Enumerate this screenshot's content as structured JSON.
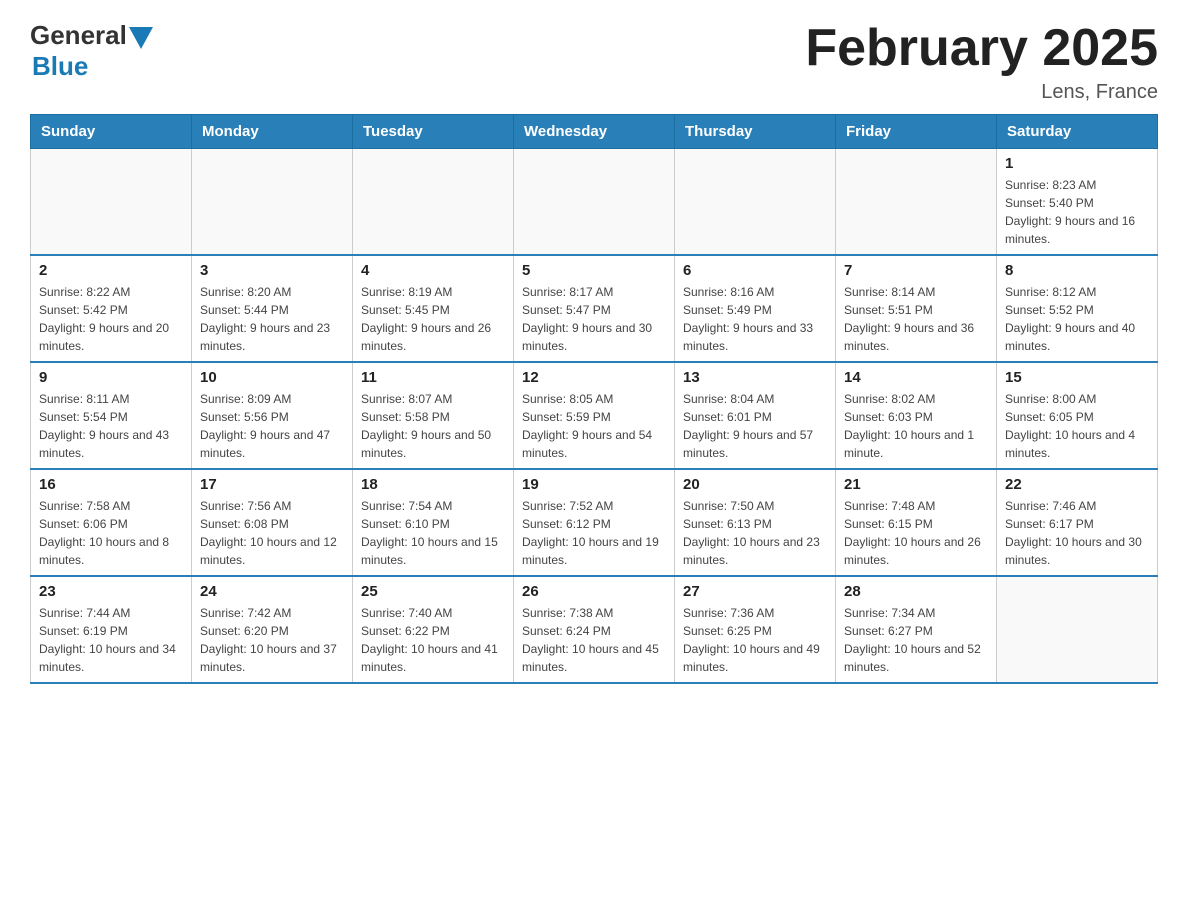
{
  "header": {
    "logo_general": "General",
    "logo_blue": "Blue",
    "month_title": "February 2025",
    "location": "Lens, France"
  },
  "days_of_week": [
    "Sunday",
    "Monday",
    "Tuesday",
    "Wednesday",
    "Thursday",
    "Friday",
    "Saturday"
  ],
  "weeks": [
    [
      {
        "date": "",
        "sunrise": "",
        "sunset": "",
        "daylight": "",
        "empty": true
      },
      {
        "date": "",
        "sunrise": "",
        "sunset": "",
        "daylight": "",
        "empty": true
      },
      {
        "date": "",
        "sunrise": "",
        "sunset": "",
        "daylight": "",
        "empty": true
      },
      {
        "date": "",
        "sunrise": "",
        "sunset": "",
        "daylight": "",
        "empty": true
      },
      {
        "date": "",
        "sunrise": "",
        "sunset": "",
        "daylight": "",
        "empty": true
      },
      {
        "date": "",
        "sunrise": "",
        "sunset": "",
        "daylight": "",
        "empty": true
      },
      {
        "date": "1",
        "sunrise": "Sunrise: 8:23 AM",
        "sunset": "Sunset: 5:40 PM",
        "daylight": "Daylight: 9 hours and 16 minutes.",
        "empty": false
      }
    ],
    [
      {
        "date": "2",
        "sunrise": "Sunrise: 8:22 AM",
        "sunset": "Sunset: 5:42 PM",
        "daylight": "Daylight: 9 hours and 20 minutes.",
        "empty": false
      },
      {
        "date": "3",
        "sunrise": "Sunrise: 8:20 AM",
        "sunset": "Sunset: 5:44 PM",
        "daylight": "Daylight: 9 hours and 23 minutes.",
        "empty": false
      },
      {
        "date": "4",
        "sunrise": "Sunrise: 8:19 AM",
        "sunset": "Sunset: 5:45 PM",
        "daylight": "Daylight: 9 hours and 26 minutes.",
        "empty": false
      },
      {
        "date": "5",
        "sunrise": "Sunrise: 8:17 AM",
        "sunset": "Sunset: 5:47 PM",
        "daylight": "Daylight: 9 hours and 30 minutes.",
        "empty": false
      },
      {
        "date": "6",
        "sunrise": "Sunrise: 8:16 AM",
        "sunset": "Sunset: 5:49 PM",
        "daylight": "Daylight: 9 hours and 33 minutes.",
        "empty": false
      },
      {
        "date": "7",
        "sunrise": "Sunrise: 8:14 AM",
        "sunset": "Sunset: 5:51 PM",
        "daylight": "Daylight: 9 hours and 36 minutes.",
        "empty": false
      },
      {
        "date": "8",
        "sunrise": "Sunrise: 8:12 AM",
        "sunset": "Sunset: 5:52 PM",
        "daylight": "Daylight: 9 hours and 40 minutes.",
        "empty": false
      }
    ],
    [
      {
        "date": "9",
        "sunrise": "Sunrise: 8:11 AM",
        "sunset": "Sunset: 5:54 PM",
        "daylight": "Daylight: 9 hours and 43 minutes.",
        "empty": false
      },
      {
        "date": "10",
        "sunrise": "Sunrise: 8:09 AM",
        "sunset": "Sunset: 5:56 PM",
        "daylight": "Daylight: 9 hours and 47 minutes.",
        "empty": false
      },
      {
        "date": "11",
        "sunrise": "Sunrise: 8:07 AM",
        "sunset": "Sunset: 5:58 PM",
        "daylight": "Daylight: 9 hours and 50 minutes.",
        "empty": false
      },
      {
        "date": "12",
        "sunrise": "Sunrise: 8:05 AM",
        "sunset": "Sunset: 5:59 PM",
        "daylight": "Daylight: 9 hours and 54 minutes.",
        "empty": false
      },
      {
        "date": "13",
        "sunrise": "Sunrise: 8:04 AM",
        "sunset": "Sunset: 6:01 PM",
        "daylight": "Daylight: 9 hours and 57 minutes.",
        "empty": false
      },
      {
        "date": "14",
        "sunrise": "Sunrise: 8:02 AM",
        "sunset": "Sunset: 6:03 PM",
        "daylight": "Daylight: 10 hours and 1 minute.",
        "empty": false
      },
      {
        "date": "15",
        "sunrise": "Sunrise: 8:00 AM",
        "sunset": "Sunset: 6:05 PM",
        "daylight": "Daylight: 10 hours and 4 minutes.",
        "empty": false
      }
    ],
    [
      {
        "date": "16",
        "sunrise": "Sunrise: 7:58 AM",
        "sunset": "Sunset: 6:06 PM",
        "daylight": "Daylight: 10 hours and 8 minutes.",
        "empty": false
      },
      {
        "date": "17",
        "sunrise": "Sunrise: 7:56 AM",
        "sunset": "Sunset: 6:08 PM",
        "daylight": "Daylight: 10 hours and 12 minutes.",
        "empty": false
      },
      {
        "date": "18",
        "sunrise": "Sunrise: 7:54 AM",
        "sunset": "Sunset: 6:10 PM",
        "daylight": "Daylight: 10 hours and 15 minutes.",
        "empty": false
      },
      {
        "date": "19",
        "sunrise": "Sunrise: 7:52 AM",
        "sunset": "Sunset: 6:12 PM",
        "daylight": "Daylight: 10 hours and 19 minutes.",
        "empty": false
      },
      {
        "date": "20",
        "sunrise": "Sunrise: 7:50 AM",
        "sunset": "Sunset: 6:13 PM",
        "daylight": "Daylight: 10 hours and 23 minutes.",
        "empty": false
      },
      {
        "date": "21",
        "sunrise": "Sunrise: 7:48 AM",
        "sunset": "Sunset: 6:15 PM",
        "daylight": "Daylight: 10 hours and 26 minutes.",
        "empty": false
      },
      {
        "date": "22",
        "sunrise": "Sunrise: 7:46 AM",
        "sunset": "Sunset: 6:17 PM",
        "daylight": "Daylight: 10 hours and 30 minutes.",
        "empty": false
      }
    ],
    [
      {
        "date": "23",
        "sunrise": "Sunrise: 7:44 AM",
        "sunset": "Sunset: 6:19 PM",
        "daylight": "Daylight: 10 hours and 34 minutes.",
        "empty": false
      },
      {
        "date": "24",
        "sunrise": "Sunrise: 7:42 AM",
        "sunset": "Sunset: 6:20 PM",
        "daylight": "Daylight: 10 hours and 37 minutes.",
        "empty": false
      },
      {
        "date": "25",
        "sunrise": "Sunrise: 7:40 AM",
        "sunset": "Sunset: 6:22 PM",
        "daylight": "Daylight: 10 hours and 41 minutes.",
        "empty": false
      },
      {
        "date": "26",
        "sunrise": "Sunrise: 7:38 AM",
        "sunset": "Sunset: 6:24 PM",
        "daylight": "Daylight: 10 hours and 45 minutes.",
        "empty": false
      },
      {
        "date": "27",
        "sunrise": "Sunrise: 7:36 AM",
        "sunset": "Sunset: 6:25 PM",
        "daylight": "Daylight: 10 hours and 49 minutes.",
        "empty": false
      },
      {
        "date": "28",
        "sunrise": "Sunrise: 7:34 AM",
        "sunset": "Sunset: 6:27 PM",
        "daylight": "Daylight: 10 hours and 52 minutes.",
        "empty": false
      },
      {
        "date": "",
        "sunrise": "",
        "sunset": "",
        "daylight": "",
        "empty": true
      }
    ]
  ]
}
